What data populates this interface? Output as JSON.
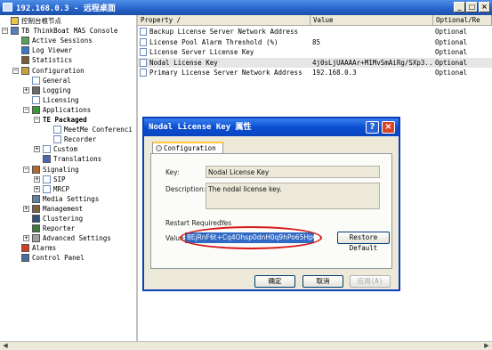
{
  "window": {
    "title": "192.168.0.3 - 远程桌面",
    "min": "_",
    "max": "□",
    "close": "×"
  },
  "tree": {
    "nodes": [
      {
        "label": "控制台根节点",
        "depth": 0,
        "exp": "",
        "icon": "folder-icon"
      },
      {
        "label": "TB ThinkBoat MAS Console",
        "depth": 0,
        "exp": "−",
        "icon": "console-icon"
      },
      {
        "label": "Active Sessions",
        "depth": 1,
        "exp": "",
        "icon": "sessions-icon"
      },
      {
        "label": "Log Viewer",
        "depth": 1,
        "exp": "",
        "icon": "log-icon"
      },
      {
        "label": "Statistics",
        "depth": 1,
        "exp": "",
        "icon": "statistics-icon"
      },
      {
        "label": "Configuration",
        "depth": 1,
        "exp": "−",
        "icon": "configuration-icon"
      },
      {
        "label": "General",
        "depth": 2,
        "exp": "",
        "icon": "page-icon"
      },
      {
        "label": "Logging",
        "depth": 2,
        "exp": "+",
        "icon": "logging-icon"
      },
      {
        "label": "Licensing",
        "depth": 2,
        "exp": "",
        "icon": "page-icon"
      },
      {
        "label": "Applications",
        "depth": 2,
        "exp": "−",
        "icon": "applications-icon"
      },
      {
        "label": "TE Packaged",
        "depth": 3,
        "exp": "−",
        "icon": "",
        "bold": true
      },
      {
        "label": "MeetMe Conferenci",
        "depth": 4,
        "exp": "",
        "icon": "page-icon"
      },
      {
        "label": "Recorder",
        "depth": 4,
        "exp": "",
        "icon": "page-icon"
      },
      {
        "label": "Custom",
        "depth": 3,
        "exp": "+",
        "icon": "page-icon"
      },
      {
        "label": "Translations",
        "depth": 3,
        "exp": "",
        "icon": "translations-icon"
      },
      {
        "label": "Signaling",
        "depth": 2,
        "exp": "−",
        "icon": "signaling-icon"
      },
      {
        "label": "SIP",
        "depth": 3,
        "exp": "+",
        "icon": "page-icon"
      },
      {
        "label": "MRCP",
        "depth": 3,
        "exp": "+",
        "icon": "page-icon"
      },
      {
        "label": "Media Settings",
        "depth": 2,
        "exp": "",
        "icon": "media-icon"
      },
      {
        "label": "Management",
        "depth": 2,
        "exp": "+",
        "icon": "management-icon"
      },
      {
        "label": "Clustering",
        "depth": 2,
        "exp": "",
        "icon": "clustering-icon"
      },
      {
        "label": "Reporter",
        "depth": 2,
        "exp": "",
        "icon": "reporter-icon"
      },
      {
        "label": "Advanced Settings",
        "depth": 2,
        "exp": "+",
        "icon": "advanced-icon"
      },
      {
        "label": "Alarms",
        "depth": 1,
        "exp": "",
        "icon": "alarm-icon"
      },
      {
        "label": "Control Panel",
        "depth": 1,
        "exp": "",
        "icon": "control-panel-icon"
      }
    ]
  },
  "list": {
    "headers": {
      "property": "Property /",
      "value": "Value",
      "optional": "Optional/Re"
    },
    "rows": [
      {
        "property": "Backup License Server Network Address",
        "value": "",
        "optional": "Optional"
      },
      {
        "property": "License Pool Alarm Threshold (%)",
        "value": "85",
        "optional": "Optional"
      },
      {
        "property": "License Server License Key",
        "value": "",
        "optional": "Optional"
      },
      {
        "property": "Nodal License Key",
        "value": "4j0sLjUAAAAr+M1MvSmAiRg/SXp3...",
        "optional": "Optional",
        "selected": true
      },
      {
        "property": "Primary License Server Network Address",
        "value": "192.168.0.3",
        "optional": "Optional"
      }
    ]
  },
  "dialog": {
    "title": "Nodal License Key 属性",
    "help": "?",
    "close": "×",
    "tab": "Configuration",
    "key_label": "Key:",
    "key_value": "Nodal License Key",
    "description_label": "Description:",
    "description_value": "The nodal license key.",
    "restart_label": "Restart Required:",
    "restart_value": "Yes",
    "value_label": "Value:",
    "value_text": "8EjRnF6t+Cq4Ohsp0dnH0q9hPo65HpGi",
    "restore_label": "Restore Default",
    "ok_label": "确定",
    "cancel_label": "取消",
    "apply_label": "应用(A)"
  },
  "colors": {
    "titlebar": "#2763c9",
    "selection": "#316ac5",
    "highlight_ring": "#d81818"
  }
}
